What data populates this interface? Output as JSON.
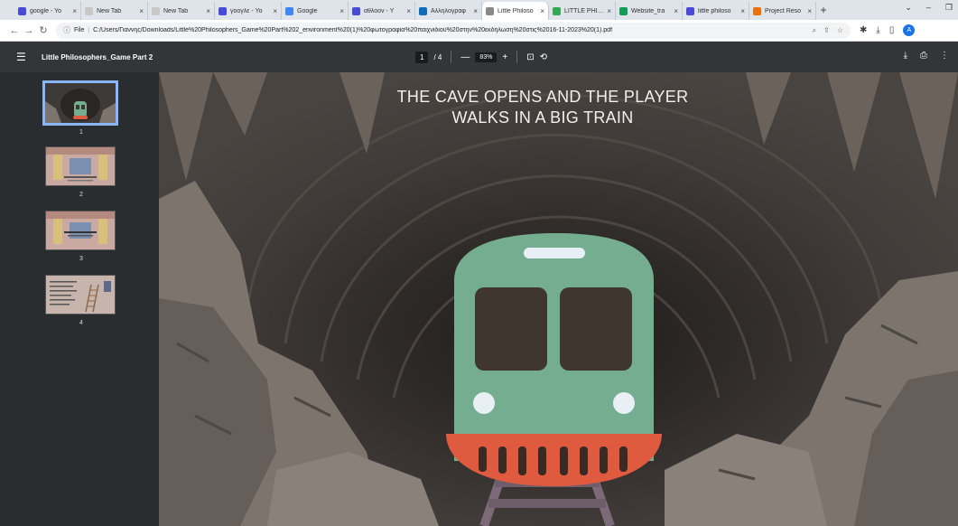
{
  "browser": {
    "tabs": [
      {
        "title": "google - Yo",
        "icon": "gmail-icon",
        "color": "#4a4ad8"
      },
      {
        "title": "New Tab",
        "icon": "blank-tab-icon",
        "color": "#c8c8c8"
      },
      {
        "title": "New Tab",
        "icon": "blank-tab-icon",
        "color": "#c8c8c8"
      },
      {
        "title": "γοογλε - Yo",
        "icon": "gmail-icon",
        "color": "#4a4ad8"
      },
      {
        "title": "Google",
        "icon": "google-icon",
        "color": "#4285f4"
      },
      {
        "title": "αθλοον - Y",
        "icon": "gmail-icon",
        "color": "#4a4ad8"
      },
      {
        "title": "Αλληλογραφ",
        "icon": "outlook-icon",
        "color": "#0f6cbd"
      },
      {
        "title": "Little Philoso",
        "icon": "globe-icon",
        "color": "#888888",
        "active": true
      },
      {
        "title": "LITTLE PHILO",
        "icon": "drive-icon",
        "color": "#34a853"
      },
      {
        "title": "Website_tra",
        "icon": "site-icon",
        "color": "#0f9d58"
      },
      {
        "title": "little philoso",
        "icon": "gmail-icon",
        "color": "#4a4ad8"
      },
      {
        "title": "Project Reso",
        "icon": "project-icon",
        "color": "#e8710a"
      }
    ],
    "new_tab": "+",
    "window_controls": [
      "⌄",
      "–",
      "❐"
    ],
    "url_scheme": "File",
    "url": "C:/Users/Γιαννης/Downloads/Little%20Philosophers_Game%20Part%202_environment%20(1)%20φωτογραφία%20παιχνιδιού%20στην%20εκδήλωση%20στις%2016-11-2023%20(1).pdf",
    "profile_initial": "A"
  },
  "pdf": {
    "title": "Little Philosophers_Game Part 2",
    "current_page": "1",
    "total_pages": "/ 4",
    "zoom": "83%",
    "thumbnails": [
      {
        "num": "1",
        "selected": true
      },
      {
        "num": "2",
        "selected": false
      },
      {
        "num": "3",
        "selected": false
      },
      {
        "num": "4",
        "selected": false
      }
    ],
    "headline_line1": "THE CAVE OPENS AND THE PLAYER",
    "headline_line2": "WALKS IN A BIG TRAIN"
  },
  "colors": {
    "cave_dark": "#2e2a28",
    "rock": "#7d746e",
    "train_body": "#74ad8f",
    "train_window": "#3f372f",
    "train_bumper": "#e05a3f",
    "headlight": "#e8f0f6"
  }
}
